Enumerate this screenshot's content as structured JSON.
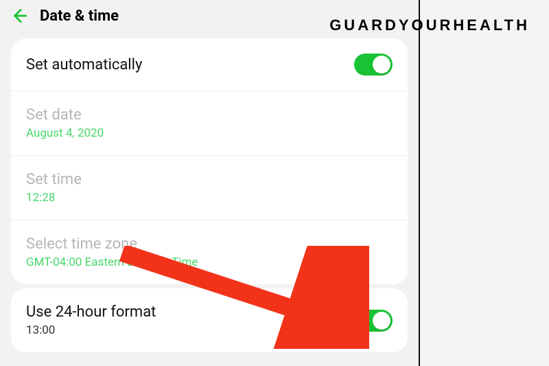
{
  "header": {
    "title": "Date & time"
  },
  "card1": {
    "auto": {
      "label": "Set automatically"
    },
    "date": {
      "label": "Set date",
      "value": "August 4, 2020"
    },
    "time": {
      "label": "Set time",
      "value": "12:28"
    },
    "tz": {
      "label": "Select time zone",
      "value": "GMT-04:00 Eastern Daylight Time"
    }
  },
  "card2": {
    "format": {
      "label": "Use 24-hour format",
      "value": "13:00"
    }
  },
  "watermark": "GUARDYOURHEALTH"
}
